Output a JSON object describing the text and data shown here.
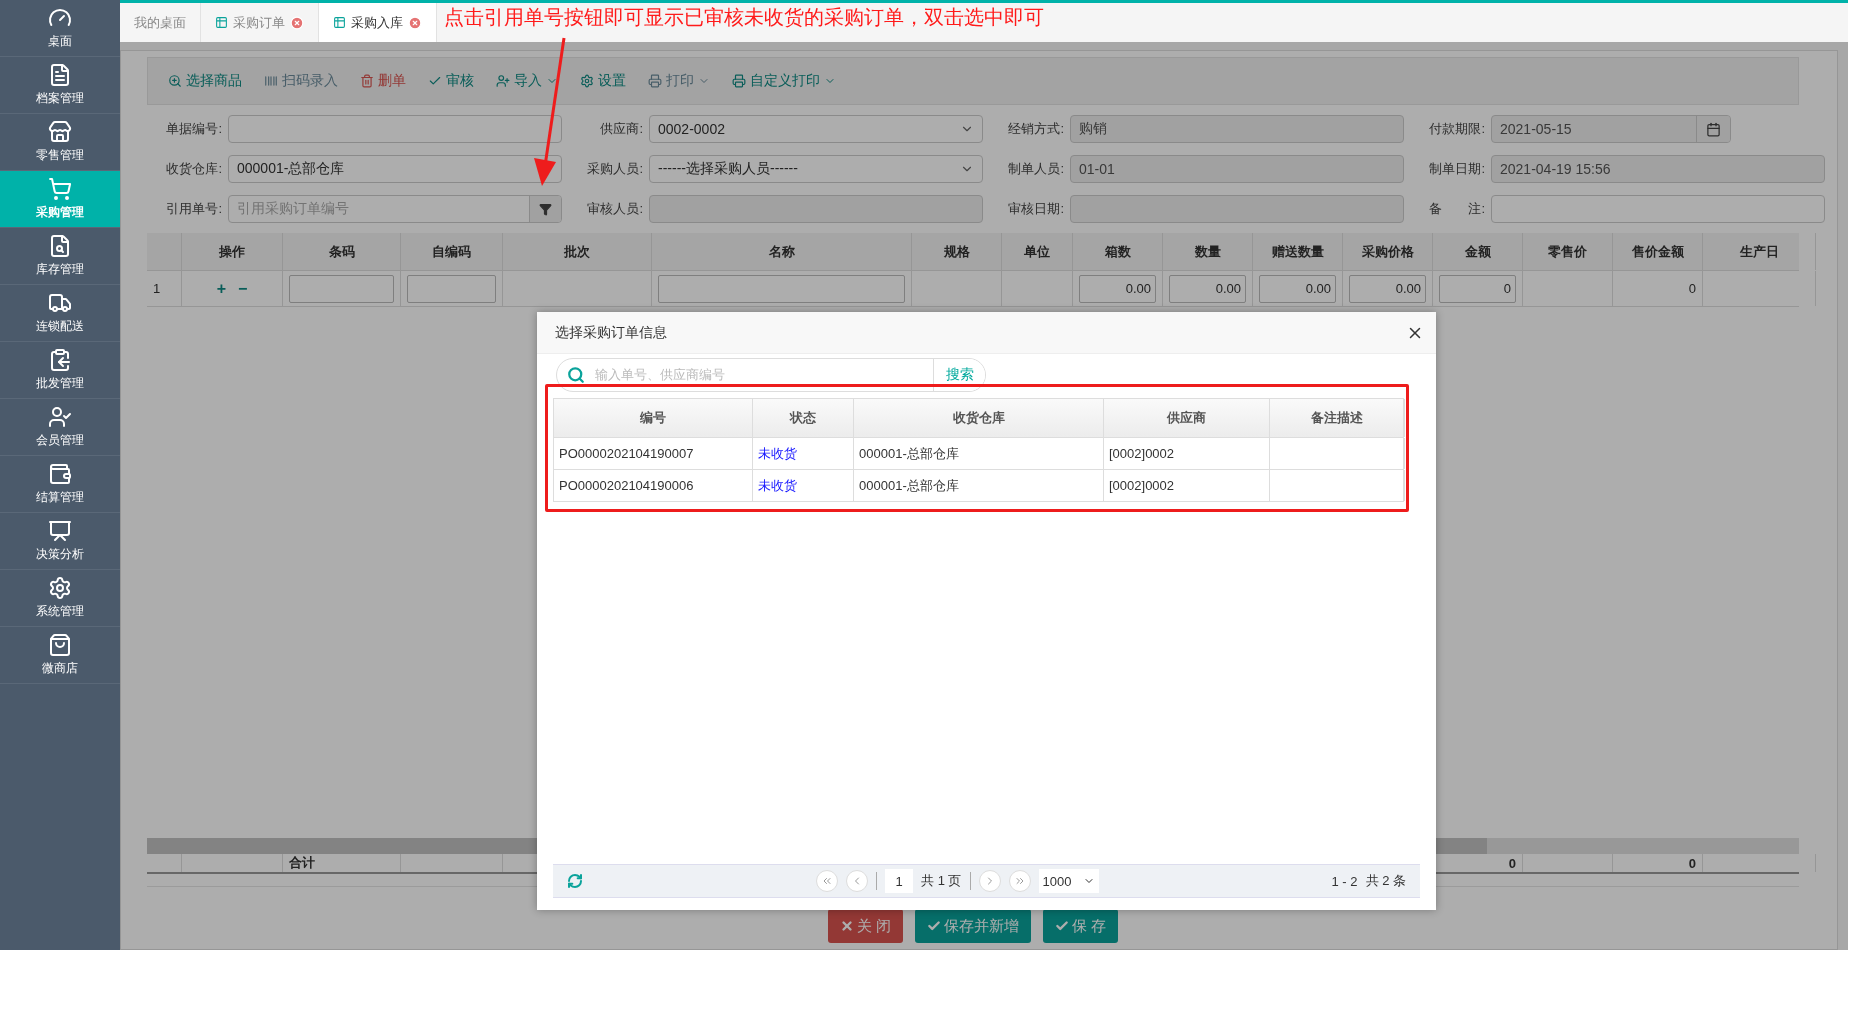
{
  "sidebar": {
    "items": [
      {
        "label": "桌面",
        "selected": false
      },
      {
        "label": "档案管理",
        "selected": false
      },
      {
        "label": "零售管理",
        "selected": false
      },
      {
        "label": "采购管理",
        "selected": true
      },
      {
        "label": "库存管理",
        "selected": false
      },
      {
        "label": "连锁配送",
        "selected": false
      },
      {
        "label": "批发管理",
        "selected": false
      },
      {
        "label": "会员管理",
        "selected": false
      },
      {
        "label": "结算管理",
        "selected": false
      },
      {
        "label": "决策分析",
        "selected": false
      },
      {
        "label": "系统管理",
        "selected": false
      },
      {
        "label": "微商店",
        "selected": false
      }
    ]
  },
  "tabs": [
    {
      "label": "我的桌面",
      "kind": "home",
      "selected": false
    },
    {
      "label": "采购订单",
      "kind": "page",
      "selected": false
    },
    {
      "label": "采购入库",
      "kind": "page",
      "selected": true
    }
  ],
  "annotation": {
    "text": "点击引用单号按钮即可显示已审核未收货的采购订单，双击选中即可"
  },
  "toolbar": [
    {
      "label": "选择商品",
      "kind": "normal",
      "dropdown": false
    },
    {
      "label": "扫码录入",
      "kind": "muted",
      "dropdown": false
    },
    {
      "label": "删单",
      "kind": "danger",
      "dropdown": false
    },
    {
      "label": "审核",
      "kind": "normal",
      "dropdown": false
    },
    {
      "label": "导入",
      "kind": "normal",
      "dropdown": true
    },
    {
      "label": "设置",
      "kind": "normal",
      "dropdown": false
    },
    {
      "label": "打印",
      "kind": "muted",
      "dropdown": true
    },
    {
      "label": "自定义打印",
      "kind": "normal",
      "dropdown": true
    }
  ],
  "form": [
    {
      "label": "单据编号:",
      "kind": "text"
    },
    {
      "label": "供应商:",
      "kind": "select",
      "value": "0002-0002"
    },
    {
      "label": "经销方式:",
      "kind": "disabled",
      "value": "购销"
    },
    {
      "label": "付款期限:",
      "kind": "date",
      "value": "2021-05-15"
    },
    {
      "label": "收货仓库:",
      "kind": "text",
      "value": "000001-总部仓库"
    },
    {
      "label": "采购人员:",
      "kind": "select",
      "value": "------选择采购人员------"
    },
    {
      "label": "制单人员:",
      "kind": "disabled",
      "value": "01-01"
    },
    {
      "label": "制单日期:",
      "kind": "disabled",
      "value": "2021-04-19 15:56"
    },
    {
      "label": "引用单号:",
      "kind": "lookup",
      "placeholder": "引用采购订单编号"
    },
    {
      "label": "审核人员:",
      "kind": "disabled"
    },
    {
      "label": "审核日期:",
      "kind": "disabled"
    },
    {
      "label": "备　　注:",
      "kind": "text"
    }
  ],
  "grid": {
    "columns": [
      "操作",
      "条码",
      "自编码",
      "批次",
      "名称",
      "规格",
      "单位",
      "箱数",
      "数量",
      "赠送数量",
      "采购价格",
      "金额",
      "零售价",
      "售价金额",
      "生产日"
    ],
    "rows": [
      {
        "number": "1",
        "cells": [
          {
            "kind": "actions",
            "add": "+",
            "remove": "−"
          },
          {
            "kind": "input"
          },
          {
            "kind": "input"
          },
          {
            "kind": "blank"
          },
          {
            "kind": "input"
          },
          {
            "kind": "blank"
          },
          {
            "kind": "blank"
          },
          {
            "kind": "number",
            "value": "0.00"
          },
          {
            "kind": "number",
            "value": "0.00"
          },
          {
            "kind": "number",
            "value": "0.00"
          },
          {
            "kind": "number",
            "value": "0.00"
          },
          {
            "kind": "number",
            "value": "0"
          },
          {
            "kind": "blank"
          },
          {
            "kind": "text",
            "value": "0"
          },
          {
            "kind": "blank"
          }
        ]
      }
    ],
    "summary": {
      "label": "合计",
      "amount": "0",
      "sale_amount": "0"
    }
  },
  "buttons": [
    {
      "label": "关 闭",
      "kind": "close"
    },
    {
      "label": "保存并新增",
      "kind": "save"
    },
    {
      "label": "保 存",
      "kind": "save"
    }
  ],
  "modal": {
    "title": "选择采购订单信息",
    "search": {
      "placeholder": "输入单号、供应商编号",
      "button": "搜索"
    },
    "columns": [
      "编号",
      "状态",
      "收货仓库",
      "供应商",
      "备注描述"
    ],
    "rows": [
      {
        "number": "PO0000202104190007",
        "status": "未收货",
        "warehouse": "000001-总部仓库",
        "supplier": "[0002]0002"
      },
      {
        "number": "PO0000202104190006",
        "status": "未收货",
        "warehouse": "000001-总部仓库",
        "supplier": "[0002]0002"
      }
    ],
    "pager": {
      "page": "1",
      "pages": "共 1 页",
      "page_size": "1000",
      "range": "1 - 2",
      "total": "共 2 条"
    }
  }
}
